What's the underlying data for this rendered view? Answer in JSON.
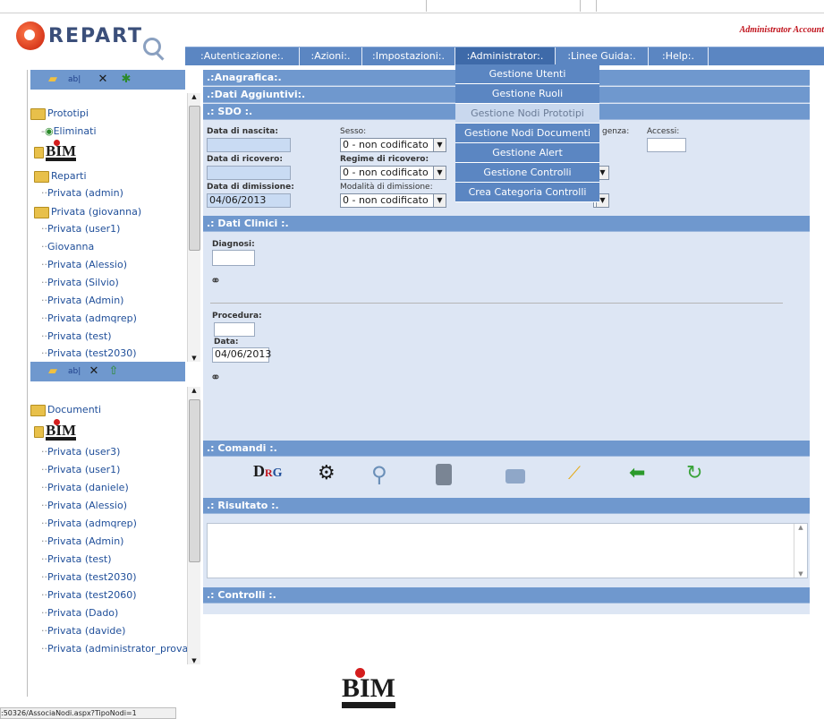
{
  "header": {
    "logo_text": "REPART",
    "account": "Administrator Account"
  },
  "menu": {
    "items": [
      ":Autenticazione:.",
      ":Azioni:.",
      ":Impostazioni:.",
      ":Administrator:.",
      ":Linee Guida:.",
      ":Help:."
    ],
    "active_index": 3
  },
  "admin_dropdown": {
    "items": [
      "Gestione Utenti",
      "Gestione Ruoli",
      "Gestione Nodi Prototipi",
      "Gestione Nodi Documenti",
      "Gestione Alert",
      "Gestione Controlli",
      "Crea Categoria Controlli"
    ],
    "hover_index": 2
  },
  "tree_prototipi": {
    "root": "Prototipi",
    "items": [
      "Eliminati",
      "BIM",
      "Reparti",
      "Privata (admin)",
      "Privata (giovanna)",
      "Privata (user1)",
      "Giovanna",
      "Privata (Alessio)",
      "Privata (Silvio)",
      "Privata (Admin)",
      "Privata (admqrep)",
      "Privata (test)",
      "Privata (test2030)"
    ]
  },
  "tree_documenti": {
    "root": "Documenti",
    "items": [
      "BIM",
      "Privata (user3)",
      "Privata (user1)",
      "Privata (daniele)",
      "Privata (Alessio)",
      "Privata (admqrep)",
      "Privata (Admin)",
      "Privata (test)",
      "Privata (test2030)",
      "Privata (test2060)",
      "Privata (Dado)",
      "Privata (davide)",
      "Privata (administrator_prova)"
    ]
  },
  "sections": {
    "anagrafica": ".:Anagrafica:.",
    "dati_aggiuntivi": ".:Dati Aggiuntivi:.",
    "sdo": ".: SDO :.",
    "dati_clinici": ".: Dati Clinici :.",
    "comandi": ".: Comandi :.",
    "risultato": ".: Risultato :.",
    "controlli": ".: Controlli :."
  },
  "sdo": {
    "data_nascita_label": "Data di nascita:",
    "data_nascita_value": "",
    "sesso_label": "Sesso:",
    "sesso_value": "0 - non codificato",
    "urgenza_label": "genza:",
    "accessi_label": "Accessi:",
    "accessi_value": "",
    "data_ricovero_label": "Data di ricovero:",
    "data_ricovero_value": "",
    "regime_label": "Regime di ricovero:",
    "regime_value": "0 - non codificato",
    "data_dimissione_label": "Data di dimissione:",
    "data_dimissione_value": "04/06/2013",
    "modalita_label": "Modalità di dimissione:",
    "modalita_value": "0 - non codificato"
  },
  "clinici": {
    "diagnosi_label": "Diagnosi:",
    "diagnosi_value": "",
    "procedura_label": "Procedura:",
    "procedura_value": "",
    "data_label": "Data:",
    "data_value": "04/06/2013"
  },
  "commands": [
    "drg-icon",
    "gears-icon",
    "magnifier-icon",
    "save-db-icon",
    "print-icon",
    "broom-icon",
    "back-arrow-icon",
    "refresh-icon"
  ],
  "status_url": ":50326/AssociaNodi.aspx?TipoNodi=1",
  "footer_logo": "BIM",
  "colors": {
    "accent": "#5b86c2",
    "section": "#6f98ce",
    "panel": "#dde6f4",
    "account": "#c0121b",
    "link": "#1f4e99"
  }
}
